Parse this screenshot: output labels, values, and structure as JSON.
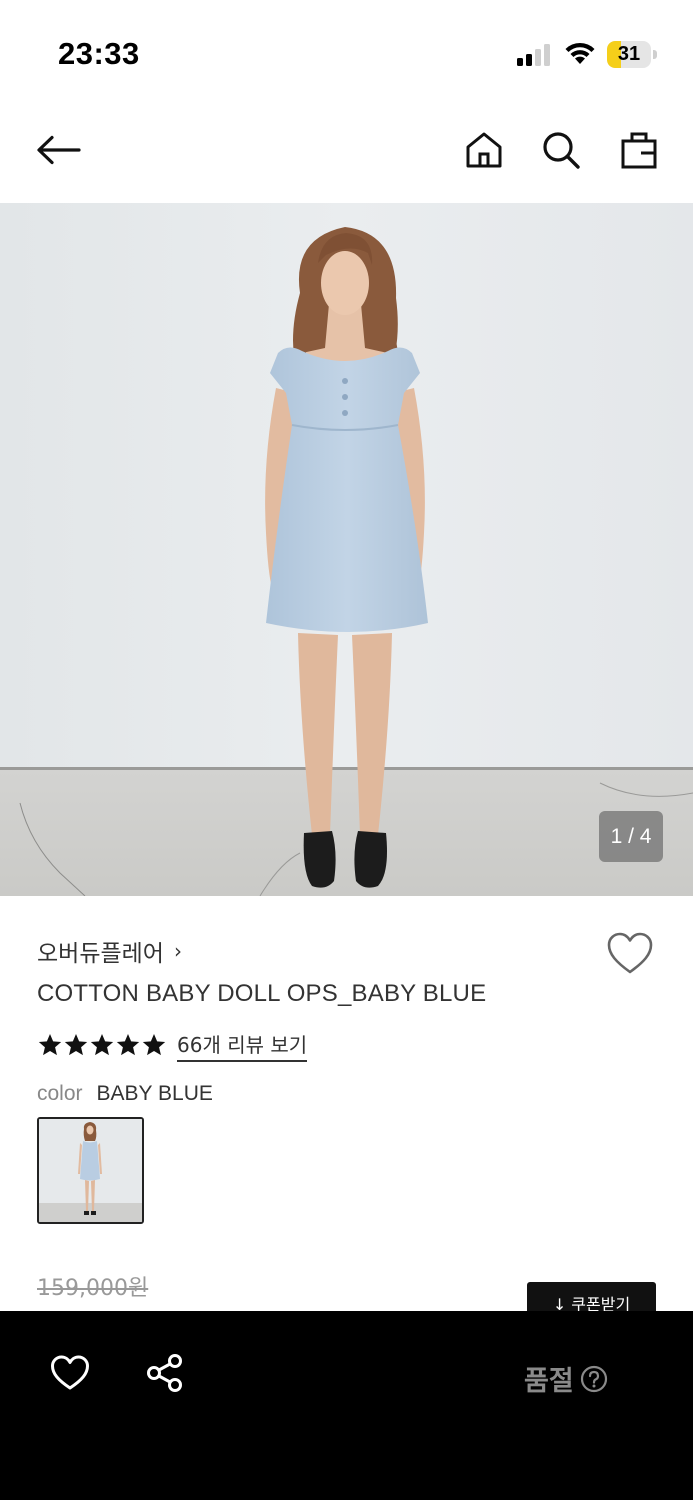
{
  "status_bar": {
    "time": "23:33",
    "battery_level": "31",
    "battery_fraction": 0.31,
    "icons": [
      "cellular-signal-icon",
      "wifi-icon",
      "battery-icon"
    ]
  },
  "header": {
    "icons": [
      "back-arrow-icon",
      "home-icon",
      "search-icon",
      "shopping-bag-icon"
    ]
  },
  "gallery": {
    "page_indicator": "1 / 4",
    "current_page": 1,
    "total_pages": 4
  },
  "product": {
    "brand": "오버듀플레어",
    "brand_chevron": "›",
    "title": "COTTON BABY DOLL OPS_BABY BLUE",
    "rating_stars": 5,
    "review_link": "66개 리뷰 보기",
    "color_label": "color",
    "color_value": "BABY BLUE",
    "original_price": "159,000원",
    "coupon_label": "↓ 쿠폰받기"
  },
  "bottom_bar": {
    "status": "품절",
    "icons": [
      "heart-icon",
      "share-icon",
      "help-icon"
    ]
  },
  "colors": {
    "background": "#ffffff",
    "text_primary": "#333333",
    "text_muted": "#888888",
    "bottom_bar": "#000000",
    "soldout_text": "#8a8a8a",
    "battery_fill": "#f5cf1a",
    "dress": "#b9cde2"
  }
}
